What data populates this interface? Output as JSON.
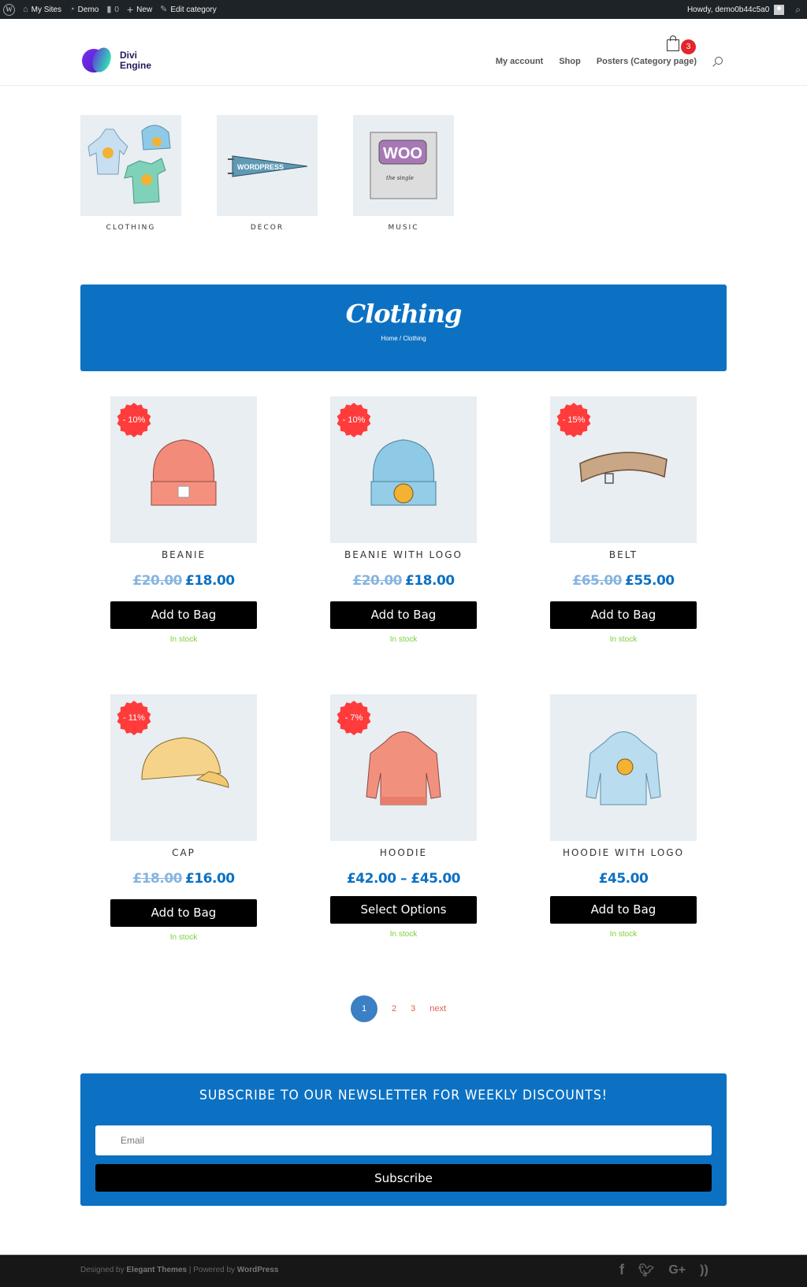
{
  "admin_bar": {
    "items": [
      {
        "icon": "wordpress-logo-icon",
        "label": ""
      },
      {
        "icon": "my-sites-icon",
        "label": "My Sites"
      },
      {
        "icon": "dashboard-icon",
        "label": "Demo"
      },
      {
        "icon": "comment-icon",
        "label": "0"
      },
      {
        "icon": "plus-icon",
        "label": "New"
      },
      {
        "icon": "pencil-icon",
        "label": "Edit category"
      }
    ],
    "greeting": "Howdy, demo0b44c5a0"
  },
  "header": {
    "logo_line1": "Divi",
    "logo_line2": "Engine",
    "nav": [
      "My account",
      "Shop",
      "Posters (Category page)"
    ],
    "cart_count": "3"
  },
  "categories": [
    {
      "label": "CLOTHING",
      "image": "clothing-collection"
    },
    {
      "label": "DECOR",
      "image": "wordpress-pennant"
    },
    {
      "label": "MUSIC",
      "image": "woo-album-cover"
    }
  ],
  "hero": {
    "title": "Clothing",
    "breadcrumb": "Home / Clothing"
  },
  "products": [
    {
      "name": "BEANIE",
      "badge": "- 10%",
      "old_price": "£20.00",
      "price": "£18.00",
      "button": "Add to Bag",
      "stock": "In stock",
      "image": "beanie"
    },
    {
      "name": "BEANIE WITH LOGO",
      "badge": "- 10%",
      "old_price": "£20.00",
      "price": "£18.00",
      "button": "Add to Bag",
      "stock": "In stock",
      "image": "beanie-logo"
    },
    {
      "name": "BELT",
      "badge": "- 15%",
      "old_price": "£65.00",
      "price": "£55.00",
      "button": "Add to Bag",
      "stock": "In stock",
      "image": "belt"
    },
    {
      "name": "CAP",
      "badge": "- 11%",
      "old_price": "£18.00",
      "price": "£16.00",
      "button": "Add to Bag",
      "stock": "In stock",
      "image": "cap"
    },
    {
      "name": "HOODIE",
      "badge": "- 7%",
      "old_price": "",
      "price": "£42.00 – £45.00",
      "button": "Select Options",
      "stock": "In stock",
      "image": "hoodie"
    },
    {
      "name": "HOODIE WITH LOGO",
      "badge": "",
      "old_price": "",
      "price": "£45.00",
      "button": "Add to Bag",
      "stock": "In stock",
      "image": "hoodie-logo"
    }
  ],
  "pagination": {
    "current": "1",
    "pages": [
      "2",
      "3"
    ],
    "next": "next"
  },
  "newsletter": {
    "title": "SUBSCRIBE TO OUR NEWSLETTER FOR WEEKLY DISCOUNTS!",
    "email_placeholder": "Email",
    "button": "Subscribe"
  },
  "footer": {
    "designed_by": "Designed by ",
    "designer": "Elegant Themes",
    "separator": " | Powered by ",
    "platform": "WordPress",
    "social": [
      "facebook",
      "twitter",
      "google-plus",
      "rss"
    ]
  },
  "colors": {
    "brand_blue": "#0c71c3",
    "sale_red": "#ff3b3b",
    "stock_green": "#7ad03a",
    "cart_badge": "#e3262c",
    "pagination_link": "#e0624c"
  }
}
